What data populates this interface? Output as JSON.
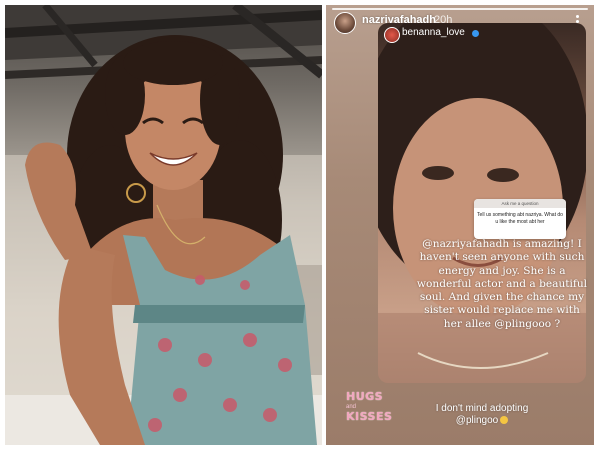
{
  "story": {
    "username": "nazriyafahadh",
    "time": "20h",
    "shared": {
      "username": "benanna_love"
    },
    "question_sticker": {
      "header": "Ask me a question",
      "question": "Tell us something abt nazriya. What do u like the most abt her"
    },
    "text": "@nazriyafahadh is amazing! I haven't seen anyone with such energy and joy. She is a wonderful actor and a beautiful soul. And given the chance my sister would replace me with her allee @plingooo ?",
    "sticker": {
      "line1": "HUGS",
      "line2": "and",
      "line3": "KISSES"
    },
    "caption_line1": "I don't mind adopting",
    "caption_line2": "@plingoo"
  }
}
